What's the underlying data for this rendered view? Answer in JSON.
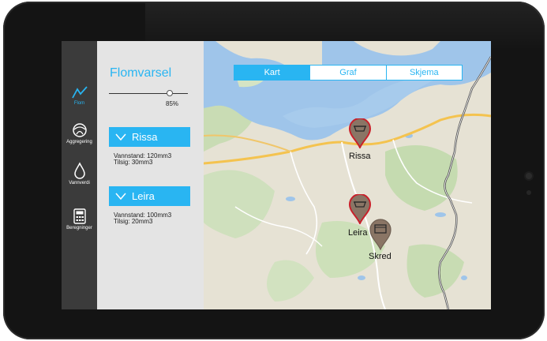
{
  "app": {
    "title": "Flomvarsel"
  },
  "nav": [
    {
      "label": "Flom",
      "icon": "chart-line-icon",
      "active": true
    },
    {
      "label": "Aggregering",
      "icon": "aggregate-icon",
      "active": false
    },
    {
      "label": "Vannverdi",
      "icon": "water-drop-icon",
      "active": false
    },
    {
      "label": "Beregninger",
      "icon": "calculator-icon",
      "active": false
    }
  ],
  "slider": {
    "value_label": "85%",
    "value": 0.85
  },
  "stations": [
    {
      "name": "Rissa",
      "line1": "Vannstand: 120mm3",
      "line2": "Tilsig: 30mm3"
    },
    {
      "name": "Leira",
      "line1": "Vannstand: 100mm3",
      "line2": "Tilsig: 20mm3"
    }
  ],
  "tabs": [
    {
      "label": "Kart",
      "active": true
    },
    {
      "label": "Graf",
      "active": false
    },
    {
      "label": "Skjema",
      "active": false
    }
  ],
  "markers": [
    {
      "label": "Rissa",
      "type": "flood",
      "color": "#c8202a"
    },
    {
      "label": "Leira",
      "type": "flood",
      "color": "#c8202a"
    },
    {
      "label": "Skred",
      "type": "landslide",
      "color": "#8a7565"
    }
  ],
  "colors": {
    "accent": "#29b5f2",
    "rail": "#3b3b3b",
    "panel": "#e4e4e4"
  }
}
